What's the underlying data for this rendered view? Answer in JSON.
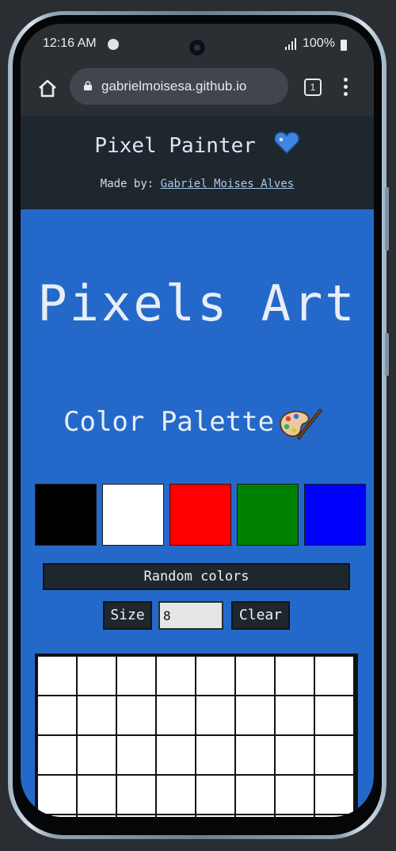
{
  "status_bar": {
    "time": "12:16 AM",
    "battery": "100%"
  },
  "browser": {
    "url": "gabrielmoisesa.github.io",
    "tab_count": "1"
  },
  "header": {
    "title": "Pixel Painter",
    "made_by_label": "Made by:",
    "author": "Gabriel Moises Alves"
  },
  "main": {
    "big_title": "Pixels Art",
    "palette_title": "Color Palette",
    "palette": [
      {
        "name": "black",
        "color": "#000000"
      },
      {
        "name": "white",
        "color": "#ffffff"
      },
      {
        "name": "red",
        "color": "#ff0000"
      },
      {
        "name": "green",
        "color": "#008000"
      },
      {
        "name": "blue",
        "color": "#0000ff"
      }
    ],
    "random_button": "Random colors",
    "size_button": "Size",
    "size_value": "8",
    "clear_button": "Clear",
    "board_columns": 8
  },
  "colors": {
    "background": "#2469c9",
    "header_bg": "#1f272e",
    "pixel": "#ffffff"
  }
}
